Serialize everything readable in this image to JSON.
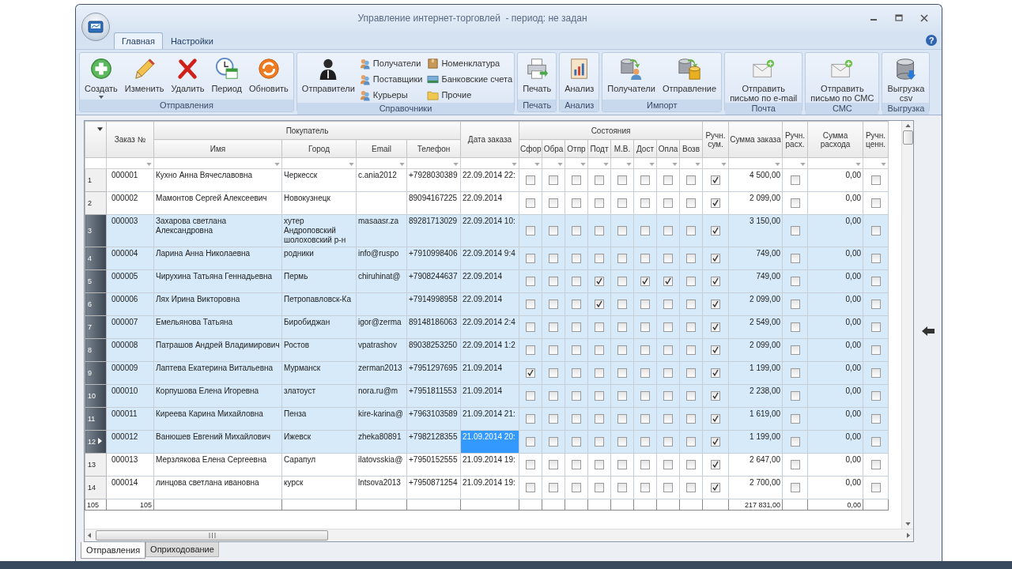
{
  "window": {
    "title": "Управление интернет-торговлей  - период: не задан"
  },
  "ribbon_tabs": [
    {
      "label": "Главная",
      "selected": true
    },
    {
      "label": "Настройки",
      "selected": false
    }
  ],
  "help_button": "?",
  "ribbon_groups": [
    {
      "label": "Отправления",
      "buttons": [
        {
          "label": "Создать",
          "kind": "large",
          "dropdown": true
        },
        {
          "label": "Изменить",
          "kind": "large"
        },
        {
          "label": "Удалить",
          "kind": "large"
        },
        {
          "label": "Период",
          "kind": "large"
        },
        {
          "label": "Обновить",
          "kind": "large"
        }
      ]
    },
    {
      "label": "Справочники",
      "buttons": [
        {
          "label": "Отправители",
          "kind": "large"
        },
        {
          "label": "Получатели",
          "kind": "small"
        },
        {
          "label": "Поставщики",
          "kind": "small"
        },
        {
          "label": "Курьеры",
          "kind": "small"
        },
        {
          "label": "Номенклатура",
          "kind": "small"
        },
        {
          "label": "Банковские счета",
          "kind": "small"
        },
        {
          "label": "Прочие",
          "kind": "small"
        }
      ]
    },
    {
      "label": "Печать",
      "buttons": [
        {
          "label": "Печать",
          "kind": "large"
        }
      ]
    },
    {
      "label": "Анализ",
      "buttons": [
        {
          "label": "Анализ",
          "kind": "large"
        }
      ]
    },
    {
      "label": "Импорт",
      "buttons": [
        {
          "label": "Получатели",
          "kind": "large"
        },
        {
          "label": "Отправление",
          "kind": "large"
        }
      ]
    },
    {
      "label": "Почта",
      "buttons": [
        {
          "label": "Отправить\nписьмо по e-mail",
          "kind": "large"
        }
      ]
    },
    {
      "label": "СМС",
      "buttons": [
        {
          "label": "Отправить\nписьмо по СМС",
          "kind": "large"
        }
      ]
    },
    {
      "label": "Выгрузка",
      "buttons": [
        {
          "label": "Выгрузка\ncsv",
          "kind": "large"
        }
      ]
    }
  ],
  "table": {
    "column_groups": [
      {
        "label": "Заказ №"
      },
      {
        "label": "Покупатель",
        "columns": [
          "Имя",
          "Город",
          "Email",
          "Телефон"
        ]
      },
      {
        "label": "Дата заказа"
      },
      {
        "label": "Состояния",
        "columns": [
          "Сфор",
          "Обра",
          "Отпр",
          "Подт",
          "М.В.",
          "Дост",
          "Опла",
          "Возв"
        ]
      },
      {
        "label": "Ручн. сум."
      },
      {
        "label": "Сумма заказа"
      },
      {
        "label": "Ручн. расх."
      },
      {
        "label": "Сумма расхода"
      },
      {
        "label": "Ручн. ценн."
      }
    ],
    "rows": [
      {
        "number": "1",
        "order": "000001",
        "name": "Кухно Анна Вячеславовна",
        "city": "Черкесск",
        "email": "c.ania2012",
        "phone": "+7928030389",
        "date": "22.09.2014 22:",
        "statuses": [
          false,
          false,
          false,
          false,
          false,
          false,
          false,
          false
        ],
        "manual_sum": true,
        "order_sum": "4 500,00",
        "manual_expense": false,
        "expense": "0,00",
        "manual_value": false,
        "selected": false,
        "current": false,
        "date_focused": false
      },
      {
        "number": "2",
        "order": "000002",
        "name": "Мамонтов Сергей Алексеевич",
        "city": "Новокузнецк",
        "phone": "89094167225",
        "date": "22.09.2014",
        "statuses": [
          false,
          false,
          false,
          false,
          false,
          false,
          false,
          false
        ],
        "manual_sum": true,
        "order_sum": "2 099,00",
        "manual_expense": false,
        "expense": "0,00",
        "manual_value": false,
        "selected": false,
        "current": false,
        "date_focused": false
      },
      {
        "number": "3",
        "order": "000003",
        "name": "Захарова светлана Александровна",
        "city": "хутер Андроповский шолоховский р-н",
        "email": "masaasr.za",
        "phone": "89281713029",
        "date": "22.09.2014 10:",
        "statuses": [
          false,
          false,
          false,
          false,
          false,
          false,
          false,
          false
        ],
        "manual_sum": true,
        "order_sum": "3 150,00",
        "manual_expense": false,
        "expense": "0,00",
        "manual_value": false,
        "selected": true,
        "current": false,
        "date_focused": false
      },
      {
        "number": "4",
        "order": "000004",
        "name": "Ларина Анна Николаевна",
        "city": "родники",
        "email": "info@ruspo",
        "phone": "+7910998406",
        "date": "22.09.2014 9:4",
        "statuses": [
          false,
          false,
          false,
          false,
          false,
          false,
          false,
          false
        ],
        "manual_sum": true,
        "order_sum": "749,00",
        "manual_expense": false,
        "expense": "0,00",
        "manual_value": false,
        "selected": true,
        "current": false,
        "date_focused": false
      },
      {
        "number": "5",
        "order": "000005",
        "name": "Чирухина Татьяна Геннадьевна",
        "city": "Пермь",
        "email": "chiruhinat@",
        "phone": "+7908244637",
        "date": "22.09.2014",
        "statuses": [
          false,
          false,
          false,
          true,
          false,
          true,
          true,
          false
        ],
        "manual_sum": true,
        "order_sum": "749,00",
        "manual_expense": false,
        "expense": "0,00",
        "manual_value": false,
        "selected": true,
        "current": false,
        "date_focused": false
      },
      {
        "number": "6",
        "order": "000006",
        "name": "Лях Ирина Викторовна",
        "city": "Петропавловск-Ка",
        "phone": "+7914998958",
        "date": "22.09.2014",
        "statuses": [
          false,
          false,
          false,
          true,
          false,
          false,
          false,
          false
        ],
        "manual_sum": true,
        "order_sum": "2 099,00",
        "manual_expense": false,
        "expense": "0,00",
        "manual_value": false,
        "selected": true,
        "current": false,
        "date_focused": false
      },
      {
        "number": "7",
        "order": "000007",
        "name": "Емельянова Татьяна",
        "city": "Биробиджан",
        "email": "igor@zerma",
        "phone": "89148186063",
        "date": "22.09.2014 2:4",
        "statuses": [
          false,
          false,
          false,
          false,
          false,
          false,
          false,
          false
        ],
        "manual_sum": true,
        "order_sum": "2 549,00",
        "manual_expense": false,
        "expense": "0,00",
        "manual_value": false,
        "selected": true,
        "current": false,
        "date_focused": false
      },
      {
        "number": "8",
        "order": "000008",
        "name": "Патрашов Андрей Владимирович",
        "city": "Ростов",
        "email": "vpatrashov",
        "phone": "89038253250",
        "date": "22.09.2014 1:2",
        "statuses": [
          false,
          false,
          false,
          false,
          false,
          false,
          false,
          false
        ],
        "manual_sum": true,
        "order_sum": "2 099,00",
        "manual_expense": false,
        "expense": "0,00",
        "manual_value": false,
        "selected": true,
        "current": false,
        "date_focused": false
      },
      {
        "number": "9",
        "order": "000009",
        "name": "Лаптева Екатерина Витальевна",
        "city": "Мурманск",
        "email": "zerman2013",
        "phone": "+7951297695",
        "date": "21.09.2014",
        "statuses": [
          true,
          false,
          false,
          false,
          false,
          false,
          false,
          false
        ],
        "manual_sum": true,
        "order_sum": "1 199,00",
        "manual_expense": false,
        "expense": "0,00",
        "manual_value": false,
        "selected": true,
        "current": false,
        "date_focused": false
      },
      {
        "number": "10",
        "order": "000010",
        "name": "Корпушова Елена Игоревна",
        "city": "златоуст",
        "email": "nora.ru@m",
        "phone": "+7951811553",
        "date": "21.09.2014",
        "statuses": [
          false,
          false,
          false,
          false,
          false,
          false,
          false,
          false
        ],
        "manual_sum": true,
        "order_sum": "2 238,00",
        "manual_expense": false,
        "expense": "0,00",
        "manual_value": false,
        "selected": true,
        "current": false,
        "date_focused": false
      },
      {
        "number": "11",
        "order": "000011",
        "name": "Киреева Карина Михайловна",
        "city": "Пенза",
        "email": "kire-karina@",
        "phone": "+7963103589",
        "date": "21.09.2014 21:",
        "statuses": [
          false,
          false,
          false,
          false,
          false,
          false,
          false,
          false
        ],
        "manual_sum": true,
        "order_sum": "1 619,00",
        "manual_expense": false,
        "expense": "0,00",
        "manual_value": false,
        "selected": true,
        "current": false,
        "date_focused": false
      },
      {
        "number": "12",
        "order": "000012",
        "name": "Ванюшев Евгений Михайлович",
        "city": "Ижевск",
        "email": "zheka80891",
        "phone": "+7982128355",
        "date": "21.09.2014 20:",
        "statuses": [
          false,
          false,
          false,
          false,
          false,
          false,
          false,
          false
        ],
        "manual_sum": true,
        "order_sum": "1 199,00",
        "manual_expense": false,
        "expense": "0,00",
        "manual_value": false,
        "selected": true,
        "current": true,
        "date_focused": true
      },
      {
        "number": "13",
        "order": "000013",
        "name": "Мерзлякова Елена Сергеевна",
        "city": "Сарапул",
        "email": "ilatovsskia@",
        "phone": "+7950152555",
        "date": "21.09.2014 19:",
        "statuses": [
          false,
          false,
          false,
          false,
          false,
          false,
          false,
          false
        ],
        "manual_sum": true,
        "order_sum": "2 647,00",
        "manual_expense": false,
        "expense": "0,00",
        "manual_value": false,
        "selected": false,
        "current": false,
        "date_focused": false
      },
      {
        "number": "14",
        "order": "000014",
        "name": "линцова светлана ивановна",
        "city": "курск",
        "email": "lntsova2013",
        "phone": "+7950871254",
        "date": "21.09.2014 19:",
        "statuses": [
          false,
          false,
          false,
          false,
          false,
          false,
          false,
          false
        ],
        "manual_sum": true,
        "order_sum": "2 700,00",
        "manual_expense": false,
        "expense": "0,00",
        "manual_value": false,
        "selected": false,
        "current": false,
        "date_focused": false
      }
    ],
    "totals": {
      "row_count": "105",
      "order_count": "105",
      "order_sum": "217 831,00",
      "expense": "0,00"
    }
  },
  "bottom_tabs": [
    {
      "label": "Отправления",
      "selected": true
    },
    {
      "label": "Оприходование",
      "selected": false
    }
  ]
}
